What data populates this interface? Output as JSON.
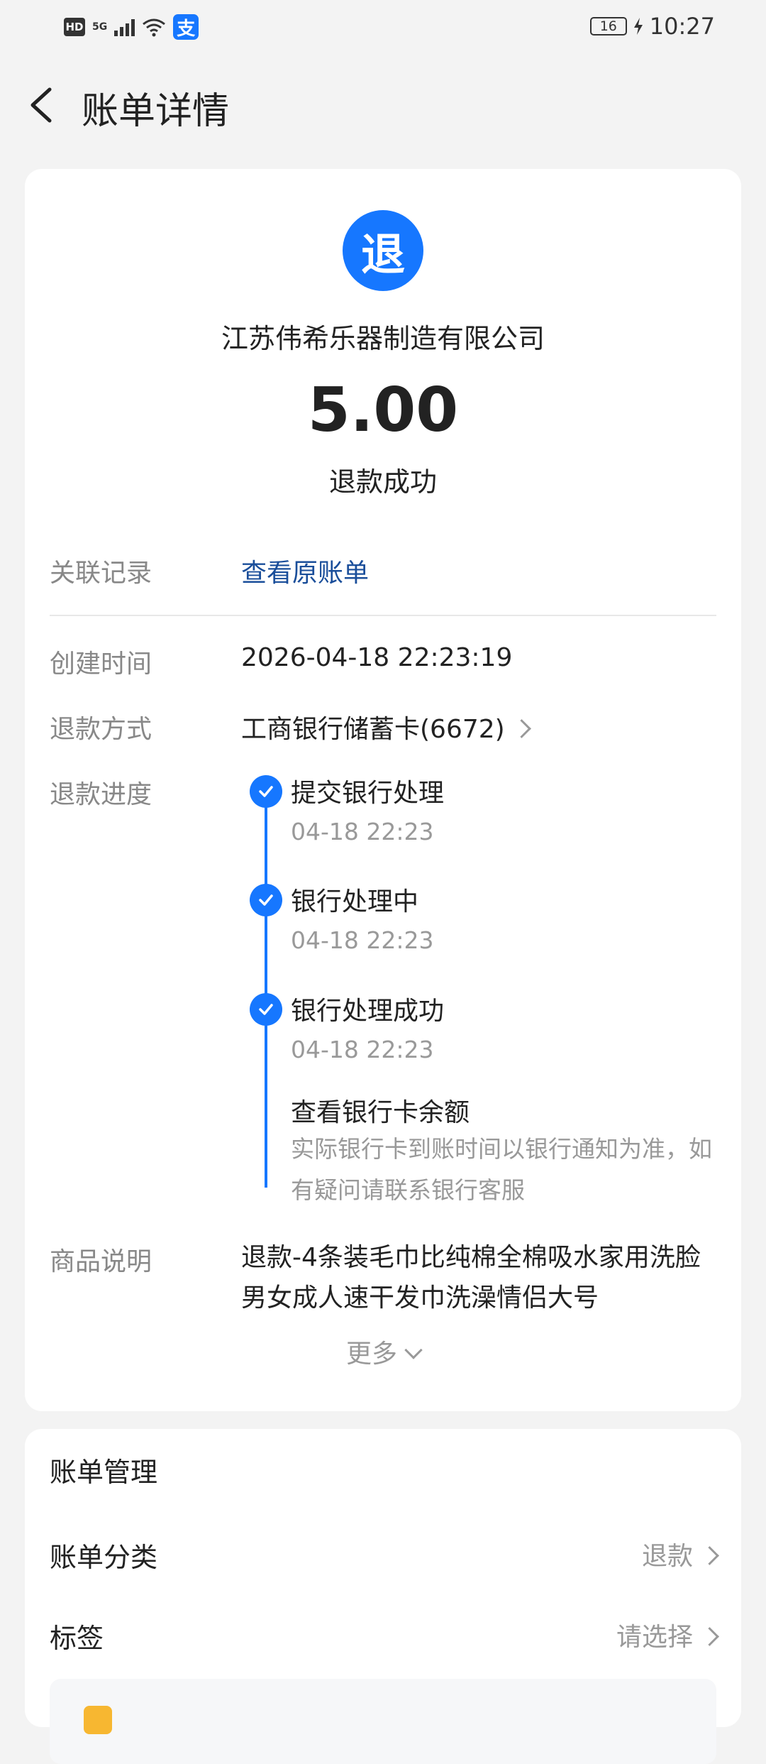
{
  "status_bar": {
    "network": "5G",
    "hd": "HD",
    "battery": "16",
    "time": "10:27",
    "app_icon": "alipay-icon"
  },
  "header": {
    "title": "账单详情"
  },
  "summary": {
    "badge": "退",
    "merchant": "江苏伟希乐器制造有限公司",
    "amount": "5.00",
    "status": "退款成功"
  },
  "details": {
    "related_label": "关联记录",
    "related_link": "查看原账单",
    "created_label": "创建时间",
    "created_value": "2026-04-18 22:23:19",
    "method_label": "退款方式",
    "method_value": "工商银行储蓄卡(6672)",
    "progress_label": "退款进度",
    "progress": [
      {
        "title": "提交银行处理",
        "time": "04-18 22:23"
      },
      {
        "title": "银行处理中",
        "time": "04-18 22:23"
      },
      {
        "title": "银行处理成功",
        "time": "04-18 22:23"
      }
    ],
    "balance_link": "查看银行卡余额",
    "note": "实际银行卡到账时间以银行通知为准，如有疑问请联系银行客服",
    "goods_label": "商品说明",
    "goods_value": "退款-4条装毛巾比纯棉全棉吸水家用洗脸男女成人速干发巾洗澡情侣大号",
    "more": "更多"
  },
  "manage": {
    "title": "账单管理",
    "category_label": "账单分类",
    "category_value": "退款",
    "tag_label": "标签",
    "tag_value": "请选择"
  },
  "colors": {
    "accent": "#1677ff",
    "link": "#1a4e9a",
    "background": "#f3f3f3"
  }
}
